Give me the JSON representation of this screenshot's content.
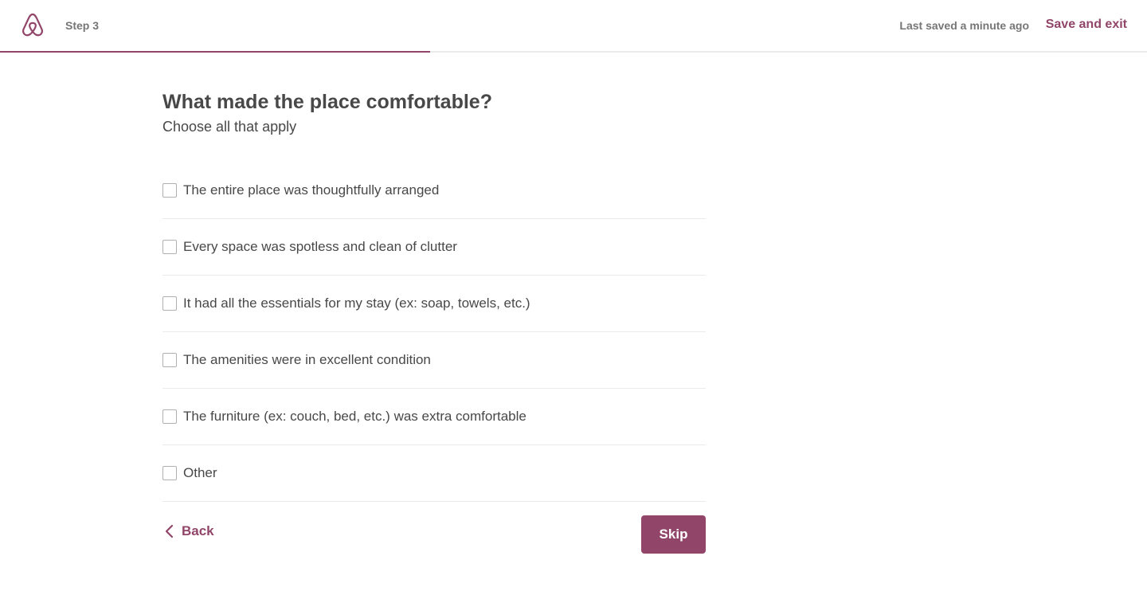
{
  "colors": {
    "accent": "#914669",
    "text_primary": "#484848",
    "text_muted": "#767676",
    "divider": "#ebebeb"
  },
  "header": {
    "logo_icon": "airbnb-logo-icon",
    "step_label": "Step 3",
    "saved_status": "Last saved a minute ago",
    "save_exit_label": "Save and exit",
    "progress_fraction": 0.375
  },
  "main": {
    "title": "What made the place comfortable?",
    "subtitle": "Choose all that apply",
    "options": [
      {
        "label": "The entire place was thoughtfully arranged",
        "checked": false
      },
      {
        "label": "Every space was spotless and clean of clutter",
        "checked": false
      },
      {
        "label": "It had all the essentials for my stay (ex: soap, towels, etc.)",
        "checked": false
      },
      {
        "label": "The amenities were in excellent condition",
        "checked": false
      },
      {
        "label": "The furniture (ex: couch, bed, etc.) was extra comfortable",
        "checked": false
      },
      {
        "label": "Other",
        "checked": false
      }
    ]
  },
  "footer": {
    "back_icon": "chevron-left-icon",
    "back_label": "Back",
    "skip_label": "Skip"
  }
}
